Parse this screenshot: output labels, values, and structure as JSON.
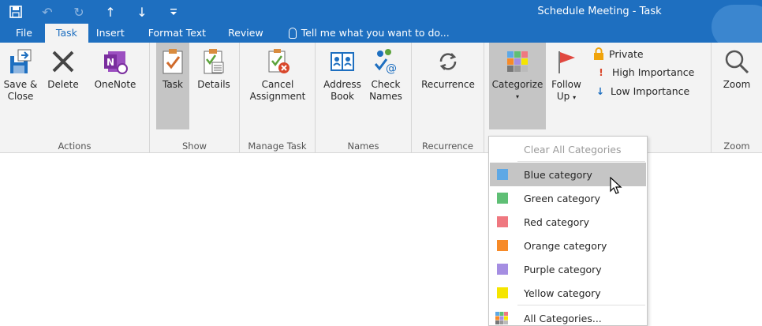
{
  "window": {
    "title": "Schedule Meeting - Task"
  },
  "qat": {
    "save": "🖫",
    "undo": "↶",
    "redo": "↻",
    "up": "↑",
    "down": "↓",
    "more": "⩡"
  },
  "tabs": [
    {
      "label": "File"
    },
    {
      "label": "Task"
    },
    {
      "label": "Insert"
    },
    {
      "label": "Format Text"
    },
    {
      "label": "Review"
    }
  ],
  "tell_me": "Tell me what you want to do...",
  "ribbon": {
    "actions": {
      "label": "Actions",
      "save_close": "Save &",
      "save_close_2": "Close",
      "delete": "Delete",
      "onenote": "OneNote"
    },
    "show": {
      "label": "Show",
      "task": "Task",
      "details": "Details"
    },
    "manage_task": {
      "label": "Manage Task",
      "cancel": "Cancel",
      "cancel_2": "Assignment"
    },
    "names": {
      "label": "Names",
      "address": "Address",
      "address_2": "Book",
      "check": "Check",
      "check_2": "Names"
    },
    "recurrence": {
      "label": "Recurrence",
      "button": "Recurrence"
    },
    "tags": {
      "categorize": "Categorize",
      "follow_up": "Follow",
      "follow_up_2": "Up",
      "private": "Private",
      "high_importance": "High Importance",
      "low_importance": "Low Importance"
    },
    "zoom": {
      "label": "Zoom",
      "button": "Zoom"
    }
  },
  "categorize_menu": {
    "clear": "Clear All Categories",
    "items": [
      {
        "label": "Blue category",
        "color": "#5ea8e5"
      },
      {
        "label": "Green category",
        "color": "#5fbf75"
      },
      {
        "label": "Red category",
        "color": "#ef7880"
      },
      {
        "label": "Orange category",
        "color": "#f78a28"
      },
      {
        "label": "Purple category",
        "color": "#a58ee2"
      },
      {
        "label": "Yellow category",
        "color": "#f5e500"
      }
    ],
    "all": "All Categories..."
  }
}
